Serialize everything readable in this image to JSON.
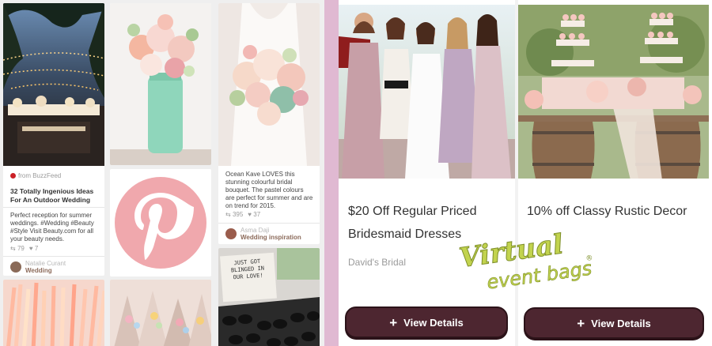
{
  "pins": {
    "lights": {
      "via": "from BuzzFeed",
      "title": "32 Totally Ingenious Ideas For An Outdoor Wedding",
      "description": "Perfect reception for summer weddings. #Wedding #Beauty #Style Visit Beauty.com for all your beauty needs.",
      "repins": "79",
      "likes": "7",
      "user_name": "Natalie Curant",
      "user_board": "Wedding"
    },
    "bouquet2": {
      "description": "Ocean Kave LOVES this stunning colourful bridal bouquet. The pastel colours are perfect for summer and are on trend for 2015.",
      "repins": "395",
      "likes": "37",
      "user_name": "Asma Daji",
      "user_board": "Wedding inspiration"
    },
    "sign": {
      "text": "JUST GOT BLINGED IN OUR LOVE!"
    }
  },
  "deals": [
    {
      "title": "$20 Off Regular Priced Bridesmaid Dresses",
      "merchant": "David's Bridal",
      "button": "View Details"
    },
    {
      "title": "10% off Classy Rustic Decor",
      "merchant": "",
      "button": "View Details"
    }
  ],
  "logo": {
    "line1": "Virtual",
    "line2": "event bags",
    "mark": "®"
  },
  "icons": {
    "repin": "repin-icon",
    "like": "heart-icon",
    "plus": "plus-icon",
    "pinterest": "pinterest-logo-icon"
  },
  "colors": {
    "pinterest_pink": "#f0a8ad",
    "button_fill": "#4d2630",
    "strip": "#e0b9d2",
    "logo_green": "#c2d34e"
  }
}
